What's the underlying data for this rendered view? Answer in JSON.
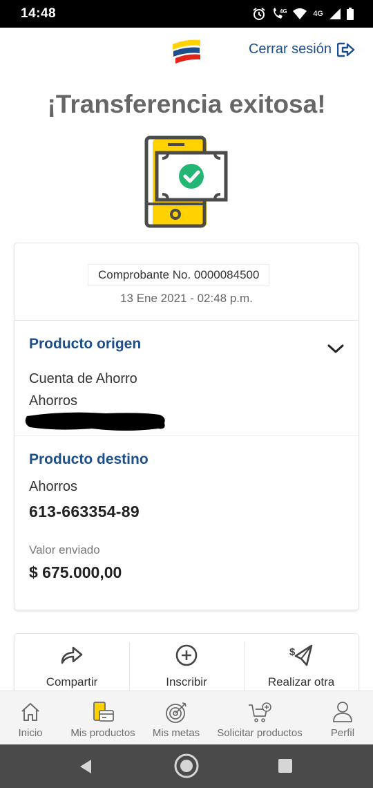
{
  "status_bar": {
    "time": "14:48",
    "network_label": "4G"
  },
  "header": {
    "logout_label": "Cerrar sesión"
  },
  "title": "¡Transferencia exitosa!",
  "receipt": {
    "voucher": "Comprobante No. 0000084500",
    "date": "13 Ene 2021 - 02:48 p.m.",
    "origin": {
      "title": "Producto origen",
      "account_name": "Cuenta de Ahorro",
      "account_type": "Ahorros"
    },
    "destination": {
      "title": "Producto destino",
      "account_type": "Ahorros",
      "account_number": "613-663354-89",
      "amount_label": "Valor enviado",
      "amount": "$ 675.000,00"
    }
  },
  "actions": [
    {
      "label": "Compartir",
      "icon": "share-icon"
    },
    {
      "label": "Inscribir",
      "icon": "plus-circle-icon"
    },
    {
      "label": "Realizar otra",
      "icon": "send-money-icon"
    }
  ],
  "bottom_nav": [
    {
      "label": "Inicio",
      "icon": "home-icon"
    },
    {
      "label": "Mis productos",
      "icon": "products-icon"
    },
    {
      "label": "Mis metas",
      "icon": "target-icon"
    },
    {
      "label": "Solicitar productos",
      "icon": "cart-add-icon"
    },
    {
      "label": "Perfil",
      "icon": "user-icon"
    }
  ],
  "colors": {
    "brand_blue": "#1b4e8a",
    "brand_yellow": "#ffd200",
    "brand_red": "#e1251b",
    "success_green": "#23b573"
  }
}
